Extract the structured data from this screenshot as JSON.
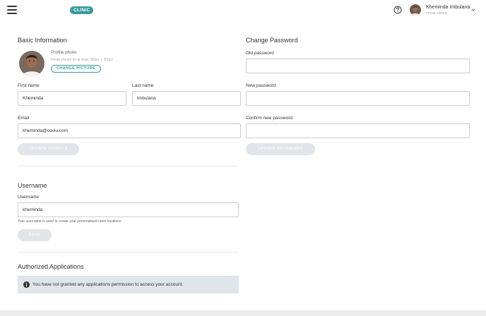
{
  "header": {
    "menu_icon": "hamburger-menu-icon",
    "clinic_badge": "CLINIC",
    "help_icon": "question-circle-icon",
    "user_name": "Kheminda Imbulana",
    "user_role": "TEAM ADMIN",
    "chevron_icon": "chevron-down-icon"
  },
  "basic_info": {
    "title": "Basic Information",
    "profile_photo_label": "Profile photo",
    "profile_photo_hint": "Photo should be at least 300px × 300px",
    "change_picture_label": "CHANGE PICTURE",
    "first_name_label": "First name",
    "first_name_value": "Kheminda",
    "last_name_label": "Last name",
    "last_name_value": "Imbulana",
    "email_label": "Email",
    "email_value": "kheminda@coviu.com",
    "update_profile_label": "UPDATE PROFILE"
  },
  "change_password": {
    "title": "Change Password",
    "old_password_label": "Old password",
    "old_password_value": "",
    "new_password_label": "New password",
    "new_password_value": "",
    "confirm_password_label": "Confirm new password",
    "confirm_password_value": "",
    "update_password_label": "UPDATE PASSWORD"
  },
  "username_section": {
    "title": "Username",
    "username_label": "Username",
    "username_value": "kheminda",
    "hint": "Your username is used to create your personalised room locations",
    "save_label": "SAVE"
  },
  "authorized_apps": {
    "title": "Authorized Applications",
    "info_icon": "info-circle-icon",
    "message": "You have not granted any applications permission to access your account."
  },
  "colors": {
    "accent": "#3a9b9b",
    "disabled_button": "#e1e4e8",
    "info_box": "#dfe5ea",
    "page_background": "#f4f5f7"
  }
}
